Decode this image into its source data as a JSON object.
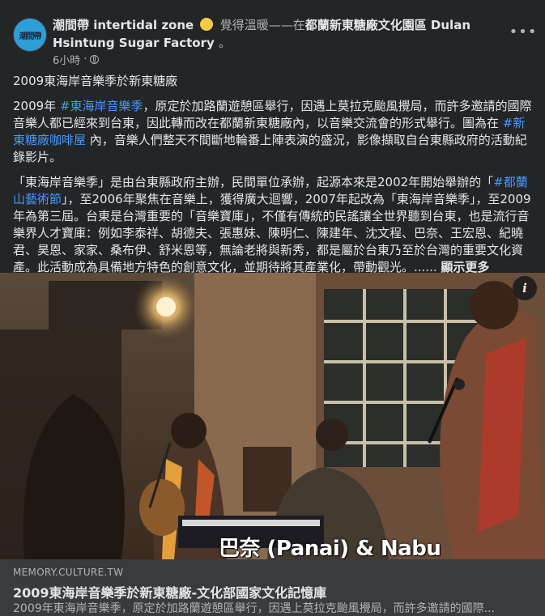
{
  "post": {
    "page_name": "潮間帶 intertidal zone",
    "feeling_text": "覺得溫暖——在",
    "location": "都蘭新東糖廠文化園區 Dulan Hsintung Sugar Factory",
    "location_suffix": "。",
    "avatar_text": "潮間帶",
    "timestamp": "6小時",
    "dot": "·",
    "more_icon": "more-horizontal-icon"
  },
  "body": {
    "headline": "2009東海岸音樂季於新東糖廠",
    "p1": {
      "a": "2009年 ",
      "tag1": "#東海岸音樂季",
      "b": "，原定於加路蘭遊憩區舉行，因遇上莫拉克颱風攪局，而許多邀請的國際音樂人都已經來到台東，因此轉而改在都蘭新東糖廠內，以音樂交流會的形式舉行。圖為在 ",
      "tag2": "#新東糖廠咖啡屋",
      "c": " 內，音樂人們整天不間斷地輪番上陣表演的盛況，影像擷取自台東縣政府的活動紀錄影片。"
    },
    "p2": {
      "a": "「東海岸音樂季」是由台東縣政府主辦，民間單位承辦，起源本來是2002年開始舉辦的「",
      "tag": "#都蘭山藝術節",
      "b": "」，至2006年聚焦在音樂上，獲得廣大迴響，2007年起改為「東海岸音樂季」，至2009年為第三屆。台東是台灣重要的「音樂寶庫」，不僅有傳統的民謠讓全世界聽到台東，也是流行音樂界人才寶庫：例如李泰祥、胡德夫、張惠妹、陳明仁、陳建年、沈文程、巴奈、王宏恩、紀曉君、昊恩、家家、桑布伊、舒米恩等，無論老將與新秀，都是屬於台東乃至於台灣的重要文化資產。此活動成為具備地方特色的創意文化，並期待將其產業化，帶動觀光。...... ",
      "see_more": "顯示更多"
    }
  },
  "media": {
    "caption": "巴奈 (Panai) & Nabu",
    "info_label": "i"
  },
  "link_card": {
    "domain": "MEMORY.CULTURE.TW",
    "title": "2009東海岸音樂季於新東糖廠-文化部國家文化記憶庫",
    "description": "2009年東海岸音樂季，原定於加路蘭遊憩區舉行，因遇上莫拉克颱風攪局，而許多邀請的國際..."
  },
  "colors": {
    "background": "#242526",
    "link": "#4599ff",
    "card": "#3a3b3c"
  }
}
